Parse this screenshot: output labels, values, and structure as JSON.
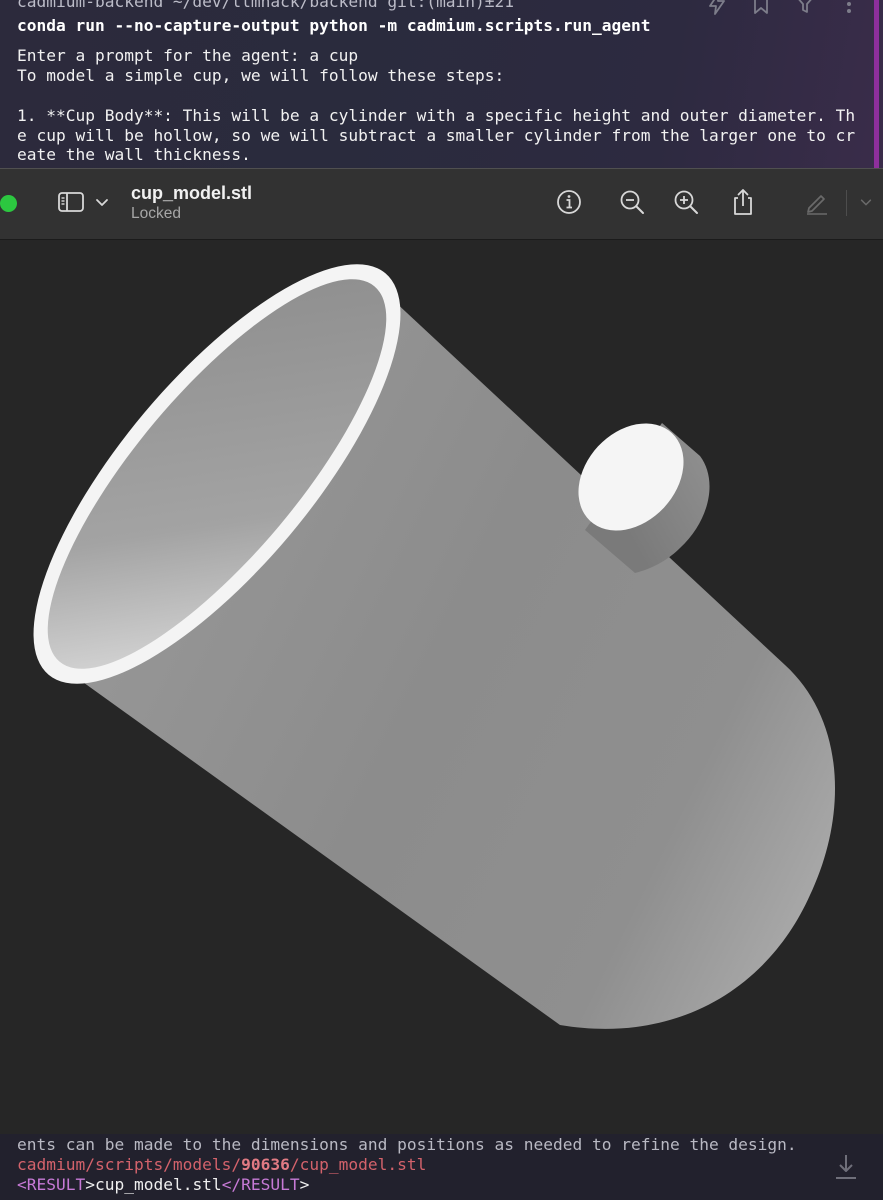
{
  "terminal": {
    "prompt_line": "cadmium-backend ~/dev/llmhack/backend git:(main)±21",
    "command": "conda run --no-capture-output python -m cadmium.scripts.run_agent",
    "output_lines": [
      "Enter a prompt for the agent: a cup",
      "To model a simple cup, we will follow these steps:",
      "",
      "1. **Cup Body**: This will be a cylinder with a specific height and outer diameter. Th",
      "e cup will be hollow, so we will subtract a smaller cylinder from the larger one to cr",
      "eate the wall thickness."
    ],
    "top_icons": [
      "bolt-icon",
      "bookmark-icon",
      "filter-icon",
      "more-icon"
    ],
    "bottom_lines": {
      "text": "ents can be made to the dimensions and positions as needed to refine the design.",
      "path_prefix": "cadmium/scripts/models/",
      "path_id": "90636",
      "path_suffix": "/cup_model.stl",
      "result_open": "<RESULT",
      "result_gt1": ">",
      "result_value": "cup_model.stl",
      "result_close": "</RESULT",
      "result_gt2": ">"
    },
    "download_icon": "download-icon"
  },
  "viewer": {
    "file_name": "cup_model.stl",
    "status": "Locked",
    "icons": {
      "window_control": "green-dot",
      "sidebar": "sidebar-icon",
      "chevron": "chevron-down-icon",
      "info": "info-icon",
      "zoom_out": "zoom-out-icon",
      "zoom_in": "zoom-in-icon",
      "share": "share-icon",
      "markup": "markup-pen-icon",
      "markup_chevron": "chevron-down-icon"
    },
    "colors": {
      "window_control": "#2cc740",
      "viewport_bg": "#262626",
      "model_light": "#f4f4f4",
      "model_shadow": "#7a7a7a"
    }
  }
}
